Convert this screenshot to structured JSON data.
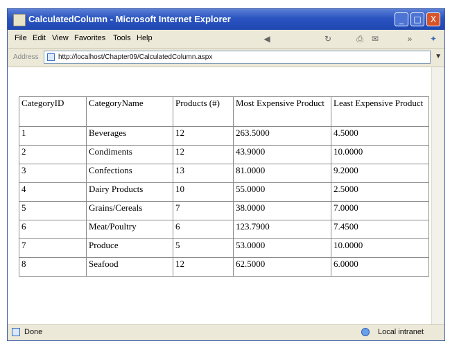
{
  "window": {
    "title": "CalculatedColumn - Microsoft Internet Explorer",
    "controls": {
      "minimize": "_",
      "maximize": "□",
      "close": "X"
    }
  },
  "menu": {
    "items": [
      "File",
      "Edit",
      "View",
      "Favorites",
      "Tools",
      "Help"
    ]
  },
  "address": {
    "label": "Address",
    "url": "http://localhost/Chapter09/CalculatedColumn.aspx"
  },
  "table": {
    "headers": [
      "CategoryID",
      "CategoryName",
      "Products (#)",
      "Most Expensive Product",
      "Least Expensive Product"
    ],
    "rows": [
      [
        "1",
        "Beverages",
        "12",
        "263.5000",
        "4.5000"
      ],
      [
        "2",
        "Condiments",
        "12",
        "43.9000",
        "10.0000"
      ],
      [
        "3",
        "Confections",
        "13",
        "81.0000",
        "9.2000"
      ],
      [
        "4",
        "Dairy Products",
        "10",
        "55.0000",
        "2.5000"
      ],
      [
        "5",
        "Grains/Cereals",
        "7",
        "38.0000",
        "7.0000"
      ],
      [
        "6",
        "Meat/Poultry",
        "6",
        "123.7900",
        "7.4500"
      ],
      [
        "7",
        "Produce",
        "5",
        "53.0000",
        "10.0000"
      ],
      [
        "8",
        "Seafood",
        "12",
        "62.5000",
        "6.0000"
      ]
    ]
  },
  "status": {
    "left": "Done",
    "right": "Local intranet"
  }
}
